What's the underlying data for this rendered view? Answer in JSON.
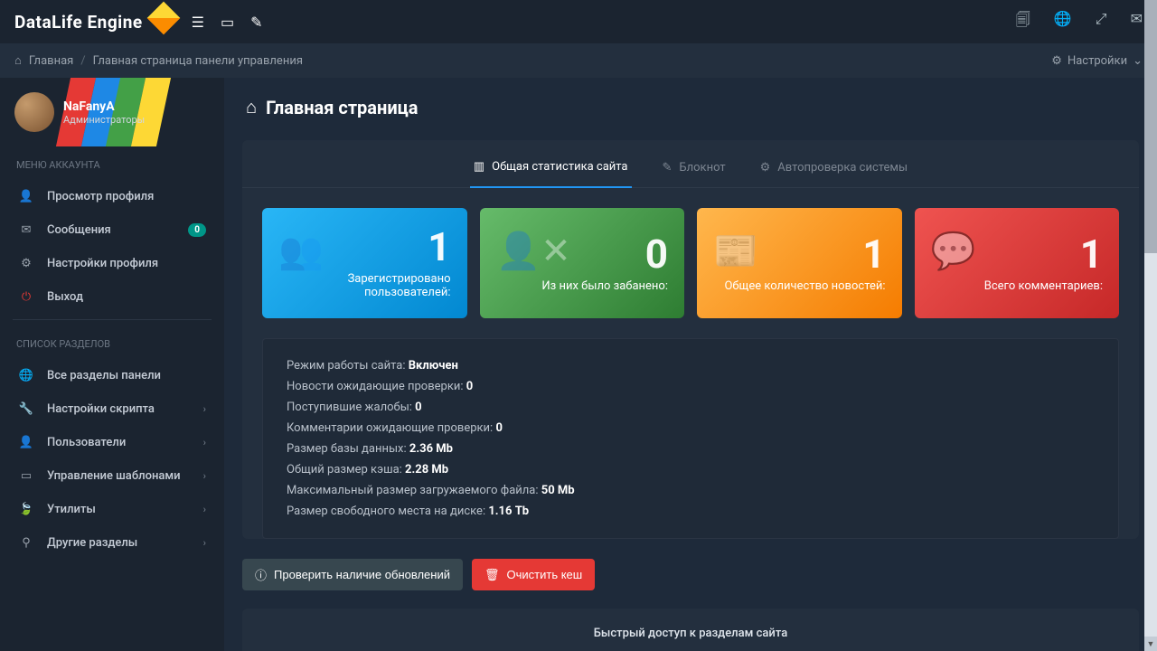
{
  "logo": "DataLife Engine",
  "breadcrumb": {
    "home": "Главная",
    "current": "Главная страница панели управления"
  },
  "settings_link": "Настройки",
  "user": {
    "name": "NaFanyA",
    "role": "Администраторы"
  },
  "sidebar": {
    "account_title": "МЕНЮ АККАУНТА",
    "sections_title": "СПИСОК РАЗДЕЛОВ",
    "account_items": [
      {
        "label": "Просмотр профиля"
      },
      {
        "label": "Сообщения",
        "badge": "0"
      },
      {
        "label": "Настройки профиля"
      },
      {
        "label": "Выход"
      }
    ],
    "section_items": [
      {
        "label": "Все разделы панели"
      },
      {
        "label": "Настройки скрипта",
        "chevron": true
      },
      {
        "label": "Пользователи",
        "chevron": true
      },
      {
        "label": "Управление шаблонами",
        "chevron": true
      },
      {
        "label": "Утилиты",
        "chevron": true
      },
      {
        "label": "Другие разделы",
        "chevron": true
      }
    ]
  },
  "page_title": "Главная страница",
  "tabs": [
    {
      "label": "Общая статистика сайта",
      "active": true
    },
    {
      "label": "Блокнот"
    },
    {
      "label": "Автопроверка системы"
    }
  ],
  "stats": [
    {
      "value": "1",
      "label": "Зарегистрировано пользователей:",
      "class": "blue"
    },
    {
      "value": "0",
      "label": "Из них было забанено:",
      "class": "green"
    },
    {
      "value": "1",
      "label": "Общее количество новостей:",
      "class": "orange"
    },
    {
      "value": "1",
      "label": "Всего комментариев:",
      "class": "red"
    }
  ],
  "info": [
    {
      "label": "Режим работы сайта:",
      "value": "Включен"
    },
    {
      "label": "Новости ожидающие проверки:",
      "value": "0"
    },
    {
      "label": "Поступившие жалобы:",
      "value": "0"
    },
    {
      "label": "Комментарии ожидающие проверки:",
      "value": "0"
    },
    {
      "label": "Размер базы данных:",
      "value": "2.36 Mb"
    },
    {
      "label": "Общий размер кэша:",
      "value": "2.28 Mb"
    },
    {
      "label": "Максимальный размер загружаемого файла:",
      "value": "50 Mb"
    },
    {
      "label": "Размер свободного места на диске:",
      "value": "1.16 Tb"
    }
  ],
  "buttons": {
    "check_updates": "Проверить наличие обновлений",
    "clear_cache": "Очистить кеш"
  },
  "quick_access_title": "Быстрый доступ к разделам сайта"
}
